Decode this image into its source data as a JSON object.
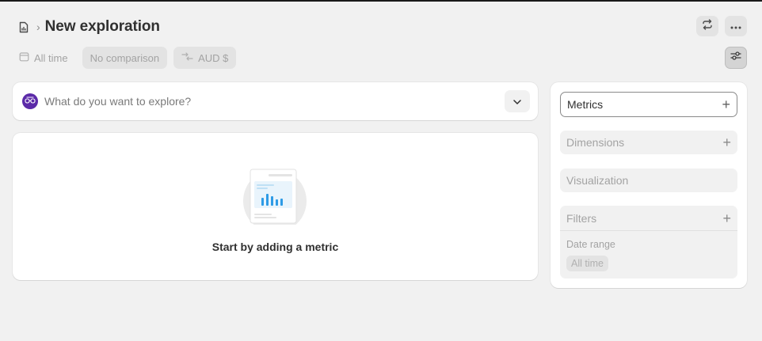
{
  "header": {
    "title": "New exploration"
  },
  "filters": {
    "date": "All time",
    "comparison": "No comparison",
    "currency": "AUD $"
  },
  "search": {
    "placeholder": "What do you want to explore?"
  },
  "empty_state": {
    "message": "Start by adding a metric"
  },
  "panel": {
    "metrics": "Metrics",
    "dimensions": "Dimensions",
    "visualization": "Visualization",
    "filters": "Filters",
    "date_range_label": "Date range",
    "date_range_value": "All time"
  },
  "icons": {
    "file": "file-chart-icon",
    "refresh": "refresh-icon",
    "more": "ellipsis-icon",
    "calendar": "calendar-icon",
    "currency": "currency-exchange-icon",
    "settings": "sliders-icon",
    "sidekick": "sidekick-avatar-icon",
    "expand": "chevron-down-icon",
    "add": "plus-icon"
  },
  "colors": {
    "background": "#f1f1f1",
    "card": "#ffffff",
    "accent_chart": "#2e9be6",
    "avatar": "#5b2aa8"
  }
}
